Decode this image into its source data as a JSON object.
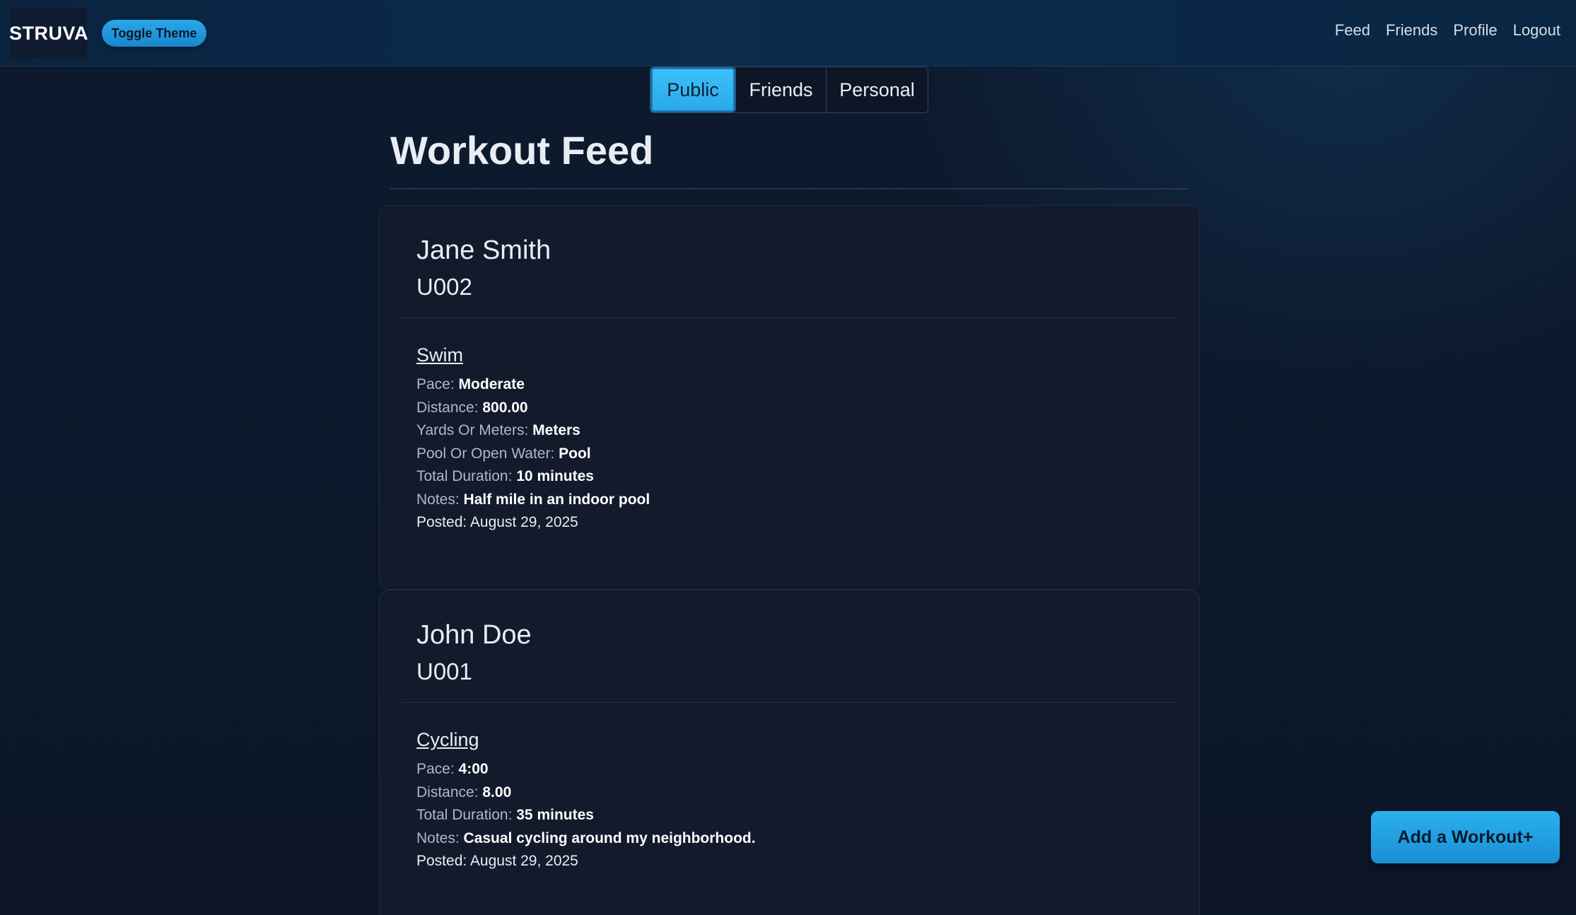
{
  "navbar": {
    "brand": "STRUVA",
    "toggle_theme_label": "Toggle Theme",
    "links": [
      "Feed",
      "Friends",
      "Profile",
      "Logout"
    ]
  },
  "tabs": [
    {
      "label": "Public",
      "active": true
    },
    {
      "label": "Friends",
      "active": false
    },
    {
      "label": "Personal",
      "active": false
    }
  ],
  "page_title": "Workout Feed",
  "posts": [
    {
      "name": "Jane Smith",
      "user_id": "U002",
      "activity": "Swim",
      "fields": [
        {
          "label": "Pace",
          "value": "Moderate"
        },
        {
          "label": "Distance",
          "value": "800.00"
        },
        {
          "label": "Yards Or Meters",
          "value": "Meters"
        },
        {
          "label": "Pool Or Open Water",
          "value": "Pool"
        },
        {
          "label": "Total Duration",
          "value": "10 minutes"
        },
        {
          "label": "Notes",
          "value": "Half mile in an indoor pool"
        }
      ],
      "posted_label": "Posted:",
      "posted_date": "August 29, 2025"
    },
    {
      "name": "John Doe",
      "user_id": "U001",
      "activity": "Cycling",
      "fields": [
        {
          "label": "Pace",
          "value": "4:00"
        },
        {
          "label": "Distance",
          "value": "8.00"
        },
        {
          "label": "Total Duration",
          "value": "35 minutes"
        },
        {
          "label": "Notes",
          "value": "Casual cycling around my neighborhood."
        }
      ],
      "posted_label": "Posted:",
      "posted_date": "August 29, 2025"
    }
  ],
  "add_workout_label": "Add a Workout+",
  "colors": {
    "accent": "#2aa9ea",
    "background": "#0c1628",
    "card": "#121a2b",
    "navbar": "#0b2b4c"
  }
}
